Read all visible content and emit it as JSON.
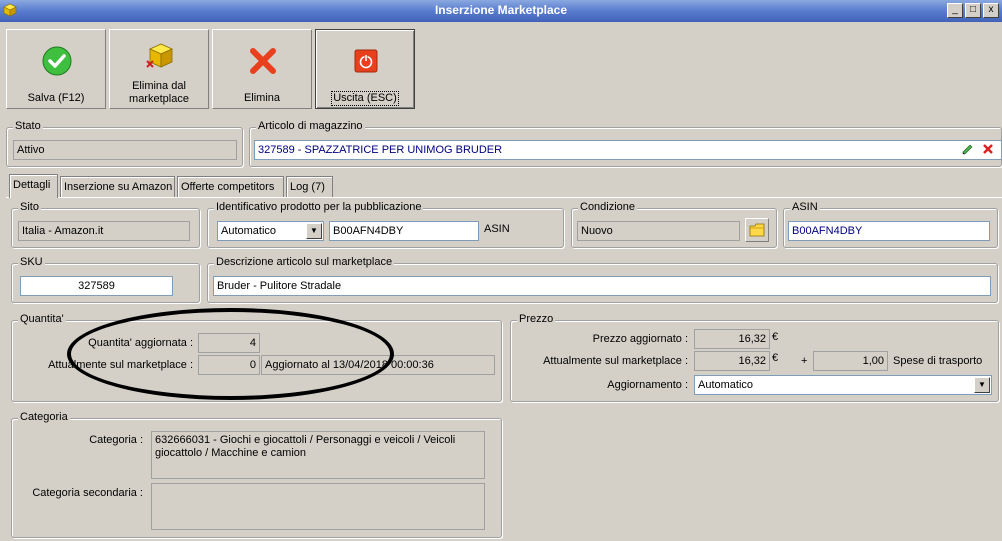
{
  "window": {
    "title": "Inserzione Marketplace",
    "minimize": "_",
    "maximize": "□",
    "close": "x"
  },
  "toolbar": {
    "save_label": "Salva (F12)",
    "delete_mp_label_1": "Elimina dal",
    "delete_mp_label_2": "marketplace",
    "delete_label": "Elimina",
    "exit_label": "Uscita (ESC)"
  },
  "stato": {
    "legend": "Stato",
    "value": "Attivo"
  },
  "articolo": {
    "legend": "Articolo di magazzino",
    "value": "327589 - SPAZZATRICE PER UNIMOG BRUDER"
  },
  "tabs": [
    {
      "label": "Dettagli"
    },
    {
      "label": "Inserzione su Amazon"
    },
    {
      "label": "Offerte competitors"
    },
    {
      "label": "Log (7)"
    }
  ],
  "sito": {
    "legend": "Sito",
    "value": "Italia - Amazon.it"
  },
  "identificativo": {
    "legend": "Identificativo prodotto per la pubblicazione",
    "mode": "Automatico",
    "code": "B00AFN4DBY",
    "type": "ASIN"
  },
  "condizione": {
    "legend": "Condizione",
    "value": "Nuovo"
  },
  "asin": {
    "legend": "ASIN",
    "value": "B00AFN4DBY"
  },
  "sku": {
    "legend": "SKU",
    "value": "327589"
  },
  "descrizione": {
    "legend": "Descrizione articolo sul marketplace",
    "value": "Bruder - Pulitore Stradale"
  },
  "quantita": {
    "legend": "Quantita'",
    "updated_label": "Quantita' aggiornata :",
    "updated_value": "4",
    "current_label": "Attualmente sul marketplace :",
    "current_value": "0",
    "updated_at": "Aggiornato al 13/04/2018 00:00:36"
  },
  "prezzo": {
    "legend": "Prezzo",
    "updated_label": "Prezzo aggiornato :",
    "updated_value": "16,32",
    "currency": "€",
    "current_label": "Attualmente sul marketplace :",
    "current_value": "16,32",
    "currency2": "€",
    "plus": "+",
    "shipping_value": "1,00",
    "shipping_label": "Spese di trasporto",
    "update_label": "Aggiornamento :",
    "update_value": "Automatico"
  },
  "categoria": {
    "legend": "Categoria",
    "label": "Categoria :",
    "value": "632666031 - Giochi e giocattoli / Personaggi e veicoli / Veicoli giocattolo / Macchine e camion",
    "secondary_label": "Categoria secondaria :",
    "secondary_value": ""
  }
}
